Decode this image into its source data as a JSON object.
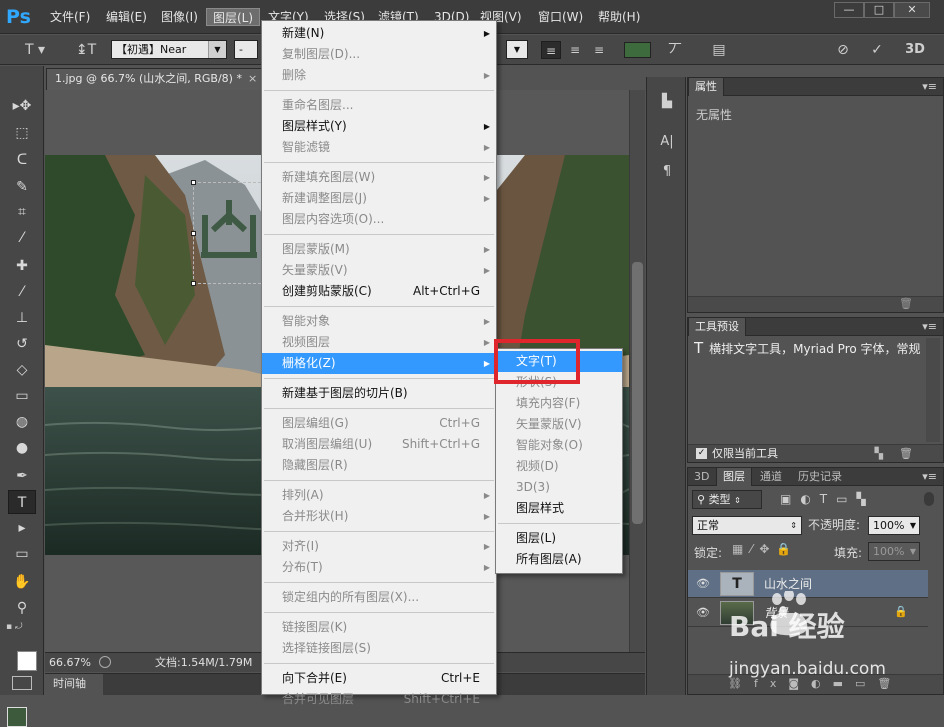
{
  "app": {
    "logo": "Ps"
  },
  "menubar": {
    "items": [
      "文件(F)",
      "编辑(E)",
      "图像(I)",
      "图层(L)",
      "文字(Y)",
      "选择(S)",
      "滤镜(T)",
      "3D(D)",
      "视图(V)",
      "窗口(W)",
      "帮助(H)"
    ],
    "active": "图层(L)",
    "win_min": "—",
    "win_max": "□",
    "win_close": "✕"
  },
  "options": {
    "font_family": "【初遇】Near",
    "font_style": "-",
    "mode_3d": "3D",
    "text_orientation_icon": "text-orientation-icon",
    "color": "#3e6b3e"
  },
  "document": {
    "tab_title": "1.jpg @ 66.7% (山水之间, RGB/8) *",
    "tab_close": "×",
    "zoom": "66.67%",
    "doc_info": "文档:1.54M/1.79M",
    "timeline_tab": "时间轴"
  },
  "layer_menu": {
    "items": [
      {
        "label": "新建(N)",
        "submenu": true
      },
      {
        "label": "复制图层(D)...",
        "disabled": true
      },
      {
        "label": "删除",
        "disabled": true,
        "submenu": true
      },
      {
        "sep": true
      },
      {
        "label": "重命名图层...",
        "disabled": true
      },
      {
        "label": "图层样式(Y)",
        "submenu": true
      },
      {
        "label": "智能滤镜",
        "disabled": true,
        "submenu": true
      },
      {
        "sep": true
      },
      {
        "label": "新建填充图层(W)",
        "disabled": true,
        "submenu": true
      },
      {
        "label": "新建调整图层(J)",
        "disabled": true,
        "submenu": true
      },
      {
        "label": "图层内容选项(O)...",
        "disabled": true
      },
      {
        "sep": true
      },
      {
        "label": "图层蒙版(M)",
        "disabled": true,
        "submenu": true
      },
      {
        "label": "矢量蒙版(V)",
        "disabled": true,
        "submenu": true
      },
      {
        "label": "创建剪贴蒙版(C)",
        "shortcut": "Alt+Ctrl+G"
      },
      {
        "sep": true
      },
      {
        "label": "智能对象",
        "disabled": true,
        "submenu": true
      },
      {
        "label": "视频图层",
        "disabled": true,
        "submenu": true
      },
      {
        "label": "栅格化(Z)",
        "highlight": true,
        "submenu": true
      },
      {
        "sep": true
      },
      {
        "label": "新建基于图层的切片(B)"
      },
      {
        "sep": true
      },
      {
        "label": "图层编组(G)",
        "disabled": true,
        "shortcut": "Ctrl+G"
      },
      {
        "label": "取消图层编组(U)",
        "disabled": true,
        "shortcut": "Shift+Ctrl+G"
      },
      {
        "label": "隐藏图层(R)",
        "disabled": true
      },
      {
        "sep": true
      },
      {
        "label": "排列(A)",
        "disabled": true,
        "submenu": true
      },
      {
        "label": "合并形状(H)",
        "disabled": true,
        "submenu": true
      },
      {
        "sep": true
      },
      {
        "label": "对齐(I)",
        "disabled": true,
        "submenu": true
      },
      {
        "label": "分布(T)",
        "disabled": true,
        "submenu": true
      },
      {
        "sep": true
      },
      {
        "label": "锁定组内的所有图层(X)...",
        "disabled": true
      },
      {
        "sep": true
      },
      {
        "label": "链接图层(K)",
        "disabled": true
      },
      {
        "label": "选择链接图层(S)",
        "disabled": true
      },
      {
        "sep": true
      },
      {
        "label": "向下合并(E)",
        "shortcut": "Ctrl+E"
      },
      {
        "label": "合并可见图层",
        "disabled": true,
        "shortcut": "Shift+Ctrl+E"
      }
    ]
  },
  "rasterize_menu": {
    "items": [
      {
        "label": "文字(T)",
        "highlight": true
      },
      {
        "label": "形状(S)",
        "disabled": true
      },
      {
        "label": "填充内容(F)",
        "disabled": true
      },
      {
        "label": "矢量蒙版(V)",
        "disabled": true
      },
      {
        "label": "智能对象(O)",
        "disabled": true
      },
      {
        "label": "视频(D)",
        "disabled": true
      },
      {
        "label": "3D(3)",
        "disabled": true
      },
      {
        "label": "图层样式"
      },
      {
        "sep": true
      },
      {
        "label": "图层(L)"
      },
      {
        "label": "所有图层(A)"
      }
    ]
  },
  "properties_panel": {
    "tab": "属性",
    "content": "无属性",
    "menu": "▾≡"
  },
  "tool_presets_panel": {
    "tab": "工具预设",
    "item": "横排文字工具，Myriad Pro 字体，常规",
    "checkbox_label": "仅限当前工具",
    "checked": true
  },
  "layers_panel": {
    "tabs": [
      "3D",
      "图层",
      "通道",
      "历史记录"
    ],
    "active_tab": "图层",
    "filter_kind": "类型",
    "blend_mode": "正常",
    "opacity_label": "不透明度:",
    "opacity": "100%",
    "lock_label": "锁定:",
    "fill_label": "填充:",
    "fill": "100%",
    "layers": [
      {
        "name": "山水之间",
        "type": "text",
        "selected": true
      },
      {
        "name": "背景",
        "type": "image",
        "locked": true
      }
    ]
  },
  "watermark": {
    "text": "Bai 经验",
    "url": "jingyan.baidu.com"
  }
}
